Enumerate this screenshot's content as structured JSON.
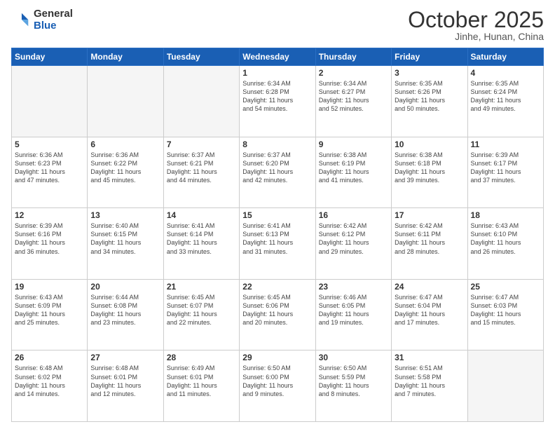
{
  "header": {
    "logo_general": "General",
    "logo_blue": "Blue",
    "month": "October 2025",
    "location": "Jinhe, Hunan, China"
  },
  "days_of_week": [
    "Sunday",
    "Monday",
    "Tuesday",
    "Wednesday",
    "Thursday",
    "Friday",
    "Saturday"
  ],
  "weeks": [
    [
      {
        "day": "",
        "info": ""
      },
      {
        "day": "",
        "info": ""
      },
      {
        "day": "",
        "info": ""
      },
      {
        "day": "1",
        "info": "Sunrise: 6:34 AM\nSunset: 6:28 PM\nDaylight: 11 hours\nand 54 minutes."
      },
      {
        "day": "2",
        "info": "Sunrise: 6:34 AM\nSunset: 6:27 PM\nDaylight: 11 hours\nand 52 minutes."
      },
      {
        "day": "3",
        "info": "Sunrise: 6:35 AM\nSunset: 6:26 PM\nDaylight: 11 hours\nand 50 minutes."
      },
      {
        "day": "4",
        "info": "Sunrise: 6:35 AM\nSunset: 6:24 PM\nDaylight: 11 hours\nand 49 minutes."
      }
    ],
    [
      {
        "day": "5",
        "info": "Sunrise: 6:36 AM\nSunset: 6:23 PM\nDaylight: 11 hours\nand 47 minutes."
      },
      {
        "day": "6",
        "info": "Sunrise: 6:36 AM\nSunset: 6:22 PM\nDaylight: 11 hours\nand 45 minutes."
      },
      {
        "day": "7",
        "info": "Sunrise: 6:37 AM\nSunset: 6:21 PM\nDaylight: 11 hours\nand 44 minutes."
      },
      {
        "day": "8",
        "info": "Sunrise: 6:37 AM\nSunset: 6:20 PM\nDaylight: 11 hours\nand 42 minutes."
      },
      {
        "day": "9",
        "info": "Sunrise: 6:38 AM\nSunset: 6:19 PM\nDaylight: 11 hours\nand 41 minutes."
      },
      {
        "day": "10",
        "info": "Sunrise: 6:38 AM\nSunset: 6:18 PM\nDaylight: 11 hours\nand 39 minutes."
      },
      {
        "day": "11",
        "info": "Sunrise: 6:39 AM\nSunset: 6:17 PM\nDaylight: 11 hours\nand 37 minutes."
      }
    ],
    [
      {
        "day": "12",
        "info": "Sunrise: 6:39 AM\nSunset: 6:16 PM\nDaylight: 11 hours\nand 36 minutes."
      },
      {
        "day": "13",
        "info": "Sunrise: 6:40 AM\nSunset: 6:15 PM\nDaylight: 11 hours\nand 34 minutes."
      },
      {
        "day": "14",
        "info": "Sunrise: 6:41 AM\nSunset: 6:14 PM\nDaylight: 11 hours\nand 33 minutes."
      },
      {
        "day": "15",
        "info": "Sunrise: 6:41 AM\nSunset: 6:13 PM\nDaylight: 11 hours\nand 31 minutes."
      },
      {
        "day": "16",
        "info": "Sunrise: 6:42 AM\nSunset: 6:12 PM\nDaylight: 11 hours\nand 29 minutes."
      },
      {
        "day": "17",
        "info": "Sunrise: 6:42 AM\nSunset: 6:11 PM\nDaylight: 11 hours\nand 28 minutes."
      },
      {
        "day": "18",
        "info": "Sunrise: 6:43 AM\nSunset: 6:10 PM\nDaylight: 11 hours\nand 26 minutes."
      }
    ],
    [
      {
        "day": "19",
        "info": "Sunrise: 6:43 AM\nSunset: 6:09 PM\nDaylight: 11 hours\nand 25 minutes."
      },
      {
        "day": "20",
        "info": "Sunrise: 6:44 AM\nSunset: 6:08 PM\nDaylight: 11 hours\nand 23 minutes."
      },
      {
        "day": "21",
        "info": "Sunrise: 6:45 AM\nSunset: 6:07 PM\nDaylight: 11 hours\nand 22 minutes."
      },
      {
        "day": "22",
        "info": "Sunrise: 6:45 AM\nSunset: 6:06 PM\nDaylight: 11 hours\nand 20 minutes."
      },
      {
        "day": "23",
        "info": "Sunrise: 6:46 AM\nSunset: 6:05 PM\nDaylight: 11 hours\nand 19 minutes."
      },
      {
        "day": "24",
        "info": "Sunrise: 6:47 AM\nSunset: 6:04 PM\nDaylight: 11 hours\nand 17 minutes."
      },
      {
        "day": "25",
        "info": "Sunrise: 6:47 AM\nSunset: 6:03 PM\nDaylight: 11 hours\nand 15 minutes."
      }
    ],
    [
      {
        "day": "26",
        "info": "Sunrise: 6:48 AM\nSunset: 6:02 PM\nDaylight: 11 hours\nand 14 minutes."
      },
      {
        "day": "27",
        "info": "Sunrise: 6:48 AM\nSunset: 6:01 PM\nDaylight: 11 hours\nand 12 minutes."
      },
      {
        "day": "28",
        "info": "Sunrise: 6:49 AM\nSunset: 6:01 PM\nDaylight: 11 hours\nand 11 minutes."
      },
      {
        "day": "29",
        "info": "Sunrise: 6:50 AM\nSunset: 6:00 PM\nDaylight: 11 hours\nand 9 minutes."
      },
      {
        "day": "30",
        "info": "Sunrise: 6:50 AM\nSunset: 5:59 PM\nDaylight: 11 hours\nand 8 minutes."
      },
      {
        "day": "31",
        "info": "Sunrise: 6:51 AM\nSunset: 5:58 PM\nDaylight: 11 hours\nand 7 minutes."
      },
      {
        "day": "",
        "info": ""
      }
    ]
  ]
}
